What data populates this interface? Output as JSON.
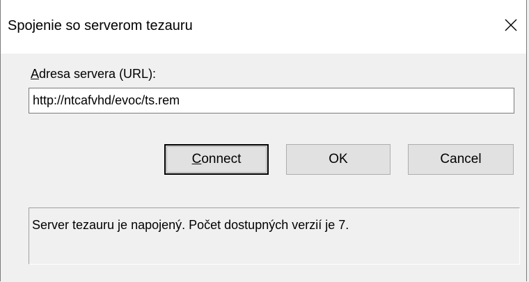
{
  "dialog": {
    "title": "Spojenie so serverom tezauru",
    "close_icon": "close-icon"
  },
  "url_field": {
    "label_accel": "A",
    "label_rest": "dresa servera (URL):",
    "value": "http://ntcafvhd/evoc/ts.rem"
  },
  "buttons": {
    "connect_accel": "C",
    "connect_rest": "onnect",
    "ok": "OK",
    "cancel": "Cancel"
  },
  "status": {
    "message": "Server tezauru je napojený. Počet dostupných verzií je 7."
  }
}
